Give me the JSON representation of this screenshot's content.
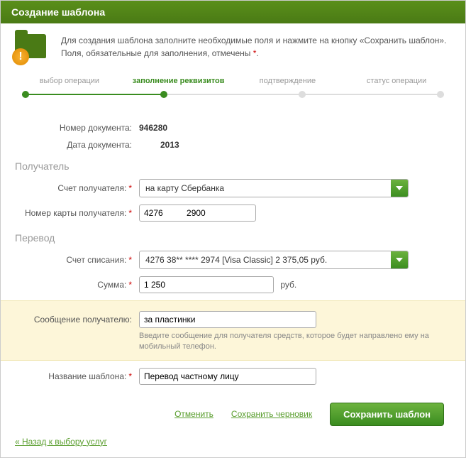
{
  "header": {
    "title": "Создание шаблона"
  },
  "intro": {
    "line1": "Для создания шаблона заполните необходимые поля и нажмите на кнопку «Сохранить шаблон».",
    "line2_a": "Поля, обязательные для заполнения, отмечены ",
    "line2_b": "."
  },
  "steps": {
    "s1": "выбор операции",
    "s2": "заполнение реквизитов",
    "s3": "подтверждение",
    "s4": "статус операции"
  },
  "fields": {
    "doc_number_label": "Номер документа:",
    "doc_number_value": "946280",
    "doc_date_label": "Дата документа:",
    "doc_date_value": "2013",
    "recipient_section": "Получатель",
    "recipient_account_label": "Счет получателя:",
    "recipient_account_value": "на карту Сбербанка",
    "recipient_card_label": "Номер карты получателя:",
    "recipient_card_value": "4276          2900",
    "transfer_section": "Перевод",
    "debit_account_label": "Счет списания:",
    "debit_account_value": "4276 38** **** 2974  [Visa Classic] 2 375,05  руб.",
    "amount_label": "Сумма:",
    "amount_value": "1 250",
    "currency": "руб.",
    "message_label": "Сообщение получателю:",
    "message_value": "за пластинки",
    "message_hint": "Введите сообщение для получателя средств, которое будет направлено ему на мобильный телефон.",
    "template_name_label": "Название шаблона:",
    "template_name_value": "Перевод частному лицу"
  },
  "actions": {
    "cancel": "Отменить",
    "save_draft": "Сохранить черновик",
    "save_template": "Сохранить шаблон"
  },
  "back_link": "« Назад к выбору услуг"
}
